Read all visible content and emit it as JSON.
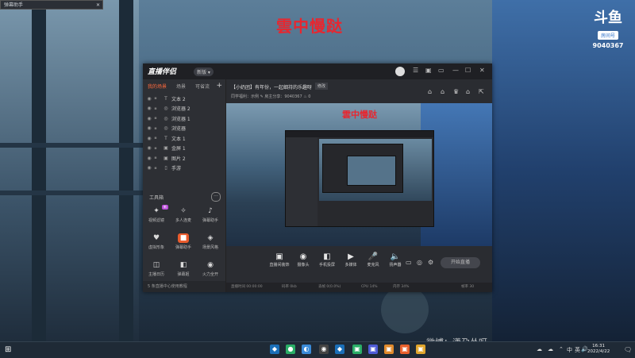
{
  "corner_tag": {
    "label": "弹幕助手",
    "close": "✕"
  },
  "overlay_title": "雲中慢跶",
  "douyu_logo": {
    "mark": "斗鱼",
    "room_tag": "房间号",
    "room_no": "9040367"
  },
  "app": {
    "brand": "直播伴侣",
    "version_chip": "新版 ▾",
    "title_controls": [
      "☰",
      "▣",
      "▭",
      "—",
      "☐",
      "✕"
    ],
    "sidebar": {
      "tabs": [
        "我的场景",
        "场景",
        "可省流"
      ],
      "add": "+",
      "sources": [
        {
          "icon": "T",
          "name": "文本 2"
        },
        {
          "icon": "◎",
          "name": "浏览器 2"
        },
        {
          "icon": "◎",
          "name": "浏览器 1"
        },
        {
          "icon": "◎",
          "name": "浏览器"
        },
        {
          "icon": "T",
          "name": "文本 1"
        },
        {
          "icon": "▣",
          "name": "金屏 1"
        },
        {
          "icon": "▣",
          "name": "图片 2"
        },
        {
          "icon": "▯",
          "name": "手游"
        }
      ],
      "toolbox_title": "工具箱",
      "toolbox_more": "···",
      "tools": [
        {
          "icon": "✦",
          "label": "视频滤镜",
          "badge": "新"
        },
        {
          "icon": "✧",
          "label": "多人连麦",
          "badge": ""
        },
        {
          "icon": "♪",
          "label": "弹幕助手",
          "badge": ""
        },
        {
          "icon": "♥",
          "label": "虚拟形象",
          "badge": ""
        },
        {
          "icon": "■",
          "label": "弹幕助手",
          "badge": ""
        },
        {
          "icon": "◈",
          "label": "场景风格",
          "badge": ""
        },
        {
          "icon": "◫",
          "label": "主播日历",
          "badge": ""
        },
        {
          "icon": "◧",
          "label": "弹幕姬",
          "badge": ""
        },
        {
          "icon": "◉",
          "label": "火力全开",
          "badge": ""
        }
      ],
      "footer": "5 条直播中心使用教程"
    },
    "room": {
      "title": "【小奶团】有年份，一起细持的乐趣呀",
      "edit": "修改",
      "meta": "同学福利：示例    ✎    房主分享：9040367    ♨ 0",
      "head_icons": [
        "⌂",
        "⌂",
        "♛",
        "⌂",
        "⇱"
      ]
    },
    "preview_title": "雲中慢跶",
    "bottom_buttons": [
      {
        "icon": "▣",
        "label": "直播间装饰"
      },
      {
        "icon": "◉",
        "label": "摄像头"
      },
      {
        "icon": "◧",
        "label": "手机投屏"
      },
      {
        "icon": "▶",
        "label": "多媒体"
      },
      {
        "icon": "🎤",
        "label": "麦克风"
      },
      {
        "icon": "🔈",
        "label": "扬声器"
      }
    ],
    "bottom_right_icons": [
      "▭",
      "◎",
      "⚙"
    ],
    "start_button": "开始直播",
    "status": [
      "直播时间 00:00:00",
      "码率 0kb",
      "丢帧 0(0.0%)",
      "CPU 14%",
      "内存 34%",
      "帧率 30"
    ]
  },
  "watermark": "微博：潇尕怂呀",
  "taskbar": {
    "start_icon": "⊞",
    "apps": [
      {
        "glyph": "◆",
        "color": "#1b6fb8"
      },
      {
        "glyph": "●",
        "color": "#2aae67"
      },
      {
        "glyph": "◐",
        "color": "#3a8bd8"
      },
      {
        "glyph": "◉",
        "color": "#444"
      },
      {
        "glyph": "◆",
        "color": "#1b6fb8"
      },
      {
        "glyph": "▣",
        "color": "#2aae67"
      },
      {
        "glyph": "▣",
        "color": "#4e5bd6"
      },
      {
        "glyph": "▣",
        "color": "#e08a2c"
      },
      {
        "glyph": "▣",
        "color": "#e8602c"
      },
      {
        "glyph": "▣",
        "color": "#e0a52c"
      }
    ],
    "tray": [
      "☁",
      "☁",
      "⌃",
      "中",
      "英",
      "🔊"
    ],
    "time": "16:31",
    "date": "2022/4/22",
    "notify": "🗨"
  }
}
